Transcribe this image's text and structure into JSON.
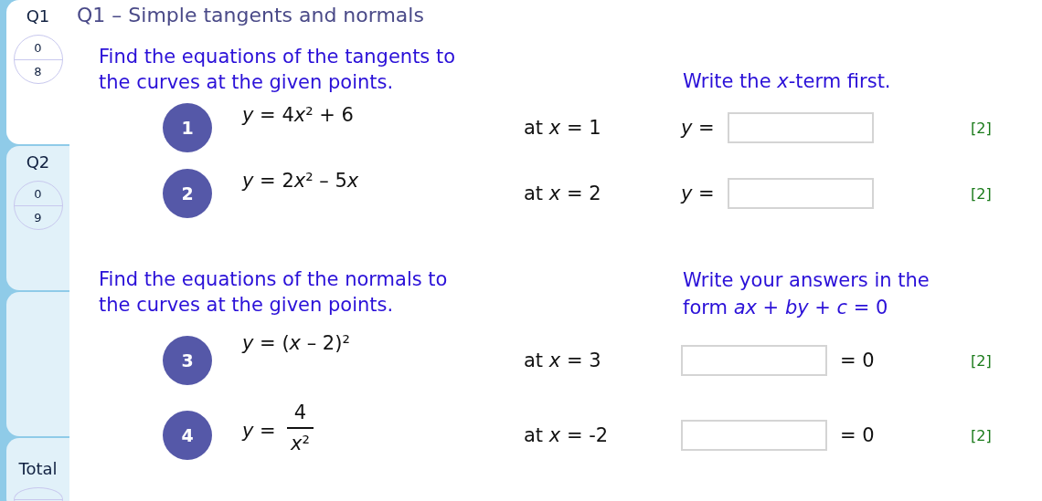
{
  "sidebar": {
    "tabs": [
      {
        "kind": "question",
        "label": "Q1",
        "selected": true,
        "score": "0",
        "total": "8"
      },
      {
        "kind": "question",
        "label": "Q2",
        "selected": false,
        "score": "0",
        "total": "9"
      },
      {
        "kind": "blank",
        "selected": false
      },
      {
        "kind": "total",
        "label": "Total",
        "selected": false
      }
    ]
  },
  "title": "Q1 – Simple tangents and normals",
  "sections": [
    {
      "instruction": "Find the equations of the tangents to the curves at the given points.",
      "hint": "Write the *x*-term first.",
      "items": [
        {
          "number": "1",
          "kind": "plain",
          "equation": [
            "*y* = 4",
            "*x*",
            "² + 6"
          ],
          "point": "at  *x* = 1",
          "answer": {
            "kind": "prefix",
            "label": "*y* ="
          },
          "marks": "[2]"
        },
        {
          "number": "2",
          "kind": "plain",
          "equation": [
            "*y* = 2",
            "*x*",
            "² – 5",
            "*x*"
          ],
          "point": "at  *x* = 2",
          "answer": {
            "kind": "prefix",
            "label": "*y* ="
          },
          "marks": "[2]"
        }
      ]
    },
    {
      "instruction": "Find the equations of the normals to the curves at the given points.",
      "hint": "Write your answers in the form *ax* + *by* + *c* = 0",
      "items": [
        {
          "number": "3",
          "kind": "plain",
          "equation": [
            "*y* = (*x* – 2)",
            "²"
          ],
          "point": "at  *x* = 3",
          "answer": {
            "kind": "suffix",
            "label": "= 0"
          },
          "marks": "[2]"
        },
        {
          "number": "4",
          "kind": "fraction",
          "lhs": "*y* =",
          "numerator": "4",
          "denominator": [
            "*x*",
            "²"
          ],
          "point": "at  *x* = -2",
          "answer": {
            "kind": "suffix",
            "label": "= 0"
          },
          "marks": "[2]"
        }
      ]
    }
  ]
}
